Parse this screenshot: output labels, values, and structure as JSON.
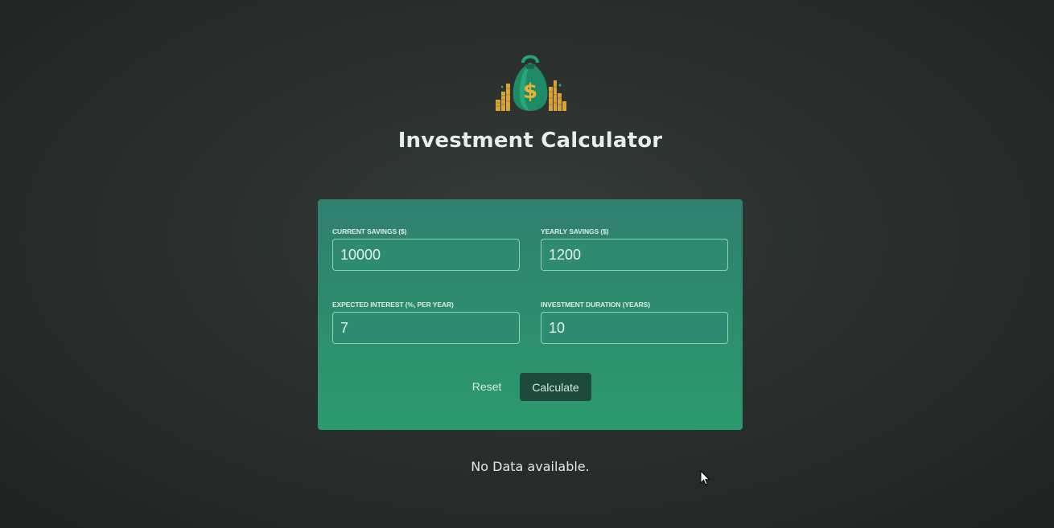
{
  "app": {
    "title": "Investment Calculator"
  },
  "icons": {
    "logo": "money-bag-icon",
    "cursor": "mouse-pointer-icon"
  },
  "colors": {
    "card_top": "#307f6f",
    "card_bottom": "#2b9a6e",
    "calculate_button": "#1d4a3d",
    "logo_accent": "#e0a82e"
  },
  "form": {
    "current_savings": {
      "label": "CURRENT SAVINGS ($)",
      "value": "10000"
    },
    "yearly_savings": {
      "label": "YEARLY SAVINGS ($)",
      "value": "1200"
    },
    "expected_interest": {
      "label": "EXPECTED INTEREST (%, PER YEAR)",
      "value": "7"
    },
    "investment_duration": {
      "label": "INVESTMENT DURATION (YEARS)",
      "value": "10"
    },
    "reset_label": "Reset",
    "calculate_label": "Calculate"
  },
  "results": {
    "message": "No Data available."
  }
}
